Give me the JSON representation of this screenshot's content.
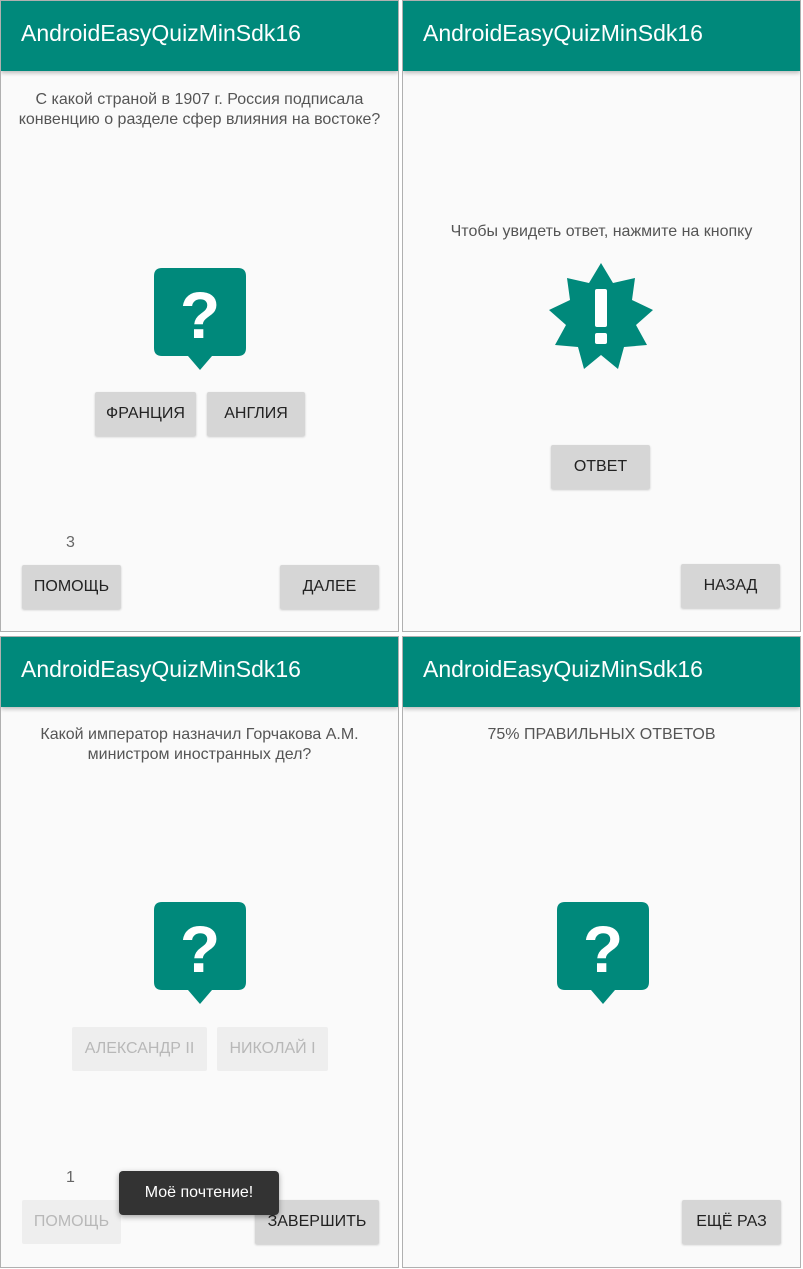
{
  "app_title": "AndroidEasyQuizMinSdk16",
  "screen1": {
    "question": "С какой страной в 1907 г. Россия подписала конвенцию о разделе сфер влияния на востоке?",
    "answers": [
      "ФРАНЦИЯ",
      "АНГЛИЯ"
    ],
    "counter": "3",
    "help_label": "ПОМОЩЬ",
    "next_label": "ДАЛЕЕ"
  },
  "screen2": {
    "hint": "Чтобы увидеть ответ, нажмите на кнопку",
    "answer_label": "ОТВЕТ",
    "back_label": "НАЗАД"
  },
  "screen3": {
    "question": "Какой император назначил Горчакова А.М. министром иностранных дел?",
    "answers": [
      "АЛЕКСАНДР II",
      "НИКОЛАЙ I"
    ],
    "counter": "1",
    "help_label": "ПОМОЩЬ",
    "finish_label": "ЗАВЕРШИТЬ",
    "toast": "Моё почтение!"
  },
  "screen4": {
    "result": "75% ПРАВИЛЬНЫХ ОТВЕТОВ",
    "retry_label": "ЕЩЁ РАЗ"
  },
  "colors": {
    "primary": "#00897b",
    "button": "#d6d6d6",
    "background": "#fafafa"
  },
  "icons": [
    "question-bubble-icon",
    "exclamation-badge-icon"
  ]
}
